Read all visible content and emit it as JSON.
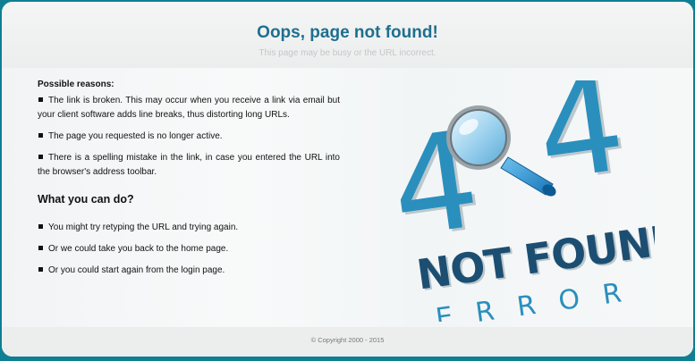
{
  "header": {
    "title": "Oops, page not found!",
    "subtitle": "This page may be busy or the URL incorrect."
  },
  "reasons": {
    "heading": "Possible reasons:",
    "items": [
      "The link is broken. This may occur when you receive a link via email but your client software adds line breaks, thus distorting long URLs.",
      "The page you requested is no longer active.",
      "There is a spelling mistake in the link, in case you entered the URL into the browser's address toolbar."
    ]
  },
  "actions": {
    "heading": "What you can do?",
    "items": [
      "You might try retyping the URL and trying again.",
      "Or we could take you back to the home page.",
      "Or you could start again from the login page."
    ]
  },
  "illustration": {
    "digit_left": "4",
    "digit_right": "4",
    "line1": "NOT FOUND",
    "line2": "ERROR",
    "icon": "magnifier-icon",
    "colors": {
      "dark": "#1c4e72",
      "light": "#2a8fbd"
    }
  },
  "footer": {
    "copyright": "© Copyright 2000 - 2015"
  }
}
